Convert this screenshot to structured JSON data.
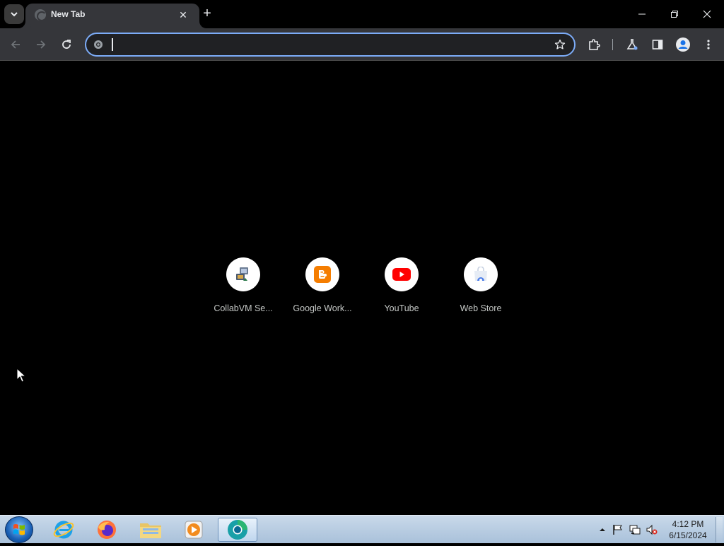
{
  "browser": {
    "tab": {
      "title": "New Tab",
      "close_glyph": "✕",
      "favicon": "chrome-globe-icon"
    },
    "new_tab_glyph": "+",
    "window_controls": {
      "minimize": "minimize-icon",
      "restore": "restore-icon",
      "close": "close-icon"
    },
    "toolbar": {
      "back": "back-arrow-icon",
      "forward": "forward-arrow-icon",
      "reload": "reload-icon",
      "omnibox": {
        "value": "",
        "placeholder": ""
      },
      "bookmark": "star-icon",
      "extensions": "puzzle-icon",
      "labs": "flask-icon",
      "side_panel": "side-panel-icon",
      "profile": "profile-avatar-icon",
      "menu": "kebab-menu-icon"
    }
  },
  "ntp": {
    "shortcuts": [
      {
        "label": "CollabVM Se...",
        "icon": "collabvm-icon"
      },
      {
        "label": "Google Work...",
        "icon": "blogger-icon"
      },
      {
        "label": "YouTube",
        "icon": "youtube-icon"
      },
      {
        "label": "Web Store",
        "icon": "web-store-icon"
      }
    ]
  },
  "taskbar": {
    "apps": [
      "internet-explorer-icon",
      "firefox-icon",
      "file-explorer-icon",
      "media-player-icon",
      "chrome-beta-icon"
    ],
    "tray": [
      "show-hidden-icons",
      "action-center-flag-icon",
      "network-icon",
      "volume-muted-icon"
    ],
    "clock": {
      "time": "4:12 PM",
      "date": "6/15/2024"
    }
  },
  "colors": {
    "accent": "#7cacf8",
    "toolbar": "#35363a",
    "page_bg": "#000000",
    "youtube_red": "#ff0000",
    "blogger_orange": "#f57d00"
  }
}
